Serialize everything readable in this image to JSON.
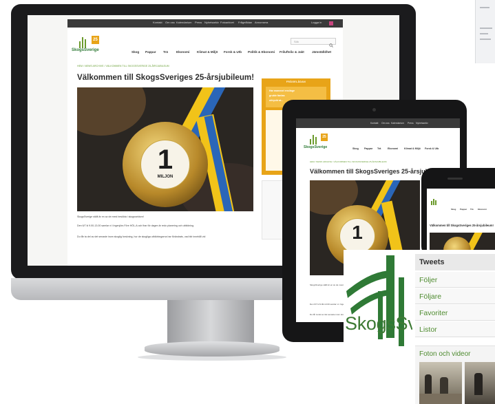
{
  "site": {
    "logo_text": "SkogsSverige",
    "badge": "25",
    "topbar_links": [
      "Kontakt",
      "Om oss",
      "Kalendarium",
      "Press",
      "Nyhetsarkiv",
      "Fotoarkivet",
      "Frågelådan",
      "Annonsera"
    ],
    "login": "Logga in",
    "nav": [
      "Skog",
      "Pappar",
      "Trä",
      "Ekonomi",
      "Klimat & Miljö",
      "Forsk & Utb",
      "Politik & Ekonomi",
      "Friluftsliv & Jakt",
      "Jämställdhet"
    ],
    "search_placeholder": "Sök",
    "breadcrumb": "HEM / NEWS ARCHIVE / VÄLKOMMEN TILL SKOGSSVERIGE 25-ÅRSJUBILEUM",
    "article_title": "Välkommen till SkogsSveriges 25-årsjubileum!",
    "medal_number": "1",
    "medal_text": "MILJON",
    "body_lines": [
      "SkogsSverige ställt är en av de mest besökta i skogssektorn!",
      "Den 6/7 kl 9.00-13.00 samlar vi i Ingenjörs Före HÖL-A och firar för dagen är redo planering och utbildning.",
      "Du får ta del av det senaste inom skoglig forskning, hur de skogliga utbildningarna har förändrats, vad blir innehåll vid"
    ],
    "sidebar_head": "FRÅGELÅDAN",
    "sidebar_lines": [
      "Har mammel ensilage",
      "gruble fantas",
      "uttryckt at..."
    ]
  },
  "overlay": {
    "logo_word": "SkogsSv",
    "panel_title": "Tweets",
    "items": [
      "Följer",
      "Följare",
      "Favoriter",
      "Listor"
    ],
    "media_title": "Foton och videor"
  },
  "colors": {
    "brand_green": "#3d7a34",
    "accent_orange": "#e8a418",
    "link_green": "#4e8b2f",
    "topbar": "#3a3a3a"
  }
}
